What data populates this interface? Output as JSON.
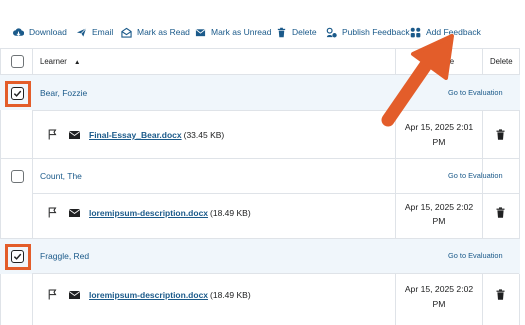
{
  "toolbar": {
    "download": "Download",
    "email": "Email",
    "mark_read": "Mark as Read",
    "mark_unread": "Mark as Unread",
    "delete": "Delete",
    "publish_feedback": "Publish Feedback",
    "add_feedback": "Add Feedback"
  },
  "table": {
    "header_learner": "Learner",
    "header_date": "ion Date",
    "header_delete": "Delete"
  },
  "rows": [
    {
      "name": "Bear, Fozzie",
      "checked": true,
      "go_eval": "Go to Evaluation",
      "file_name": "Final-Essay_Bear.docx",
      "file_size": "(33.45 KB)",
      "date_line1": "Apr 15, 2025 2:01",
      "date_line2": "PM"
    },
    {
      "name": "Count, The",
      "checked": false,
      "go_eval": "Go to Evaluation",
      "file_name": "loremipsum-description.docx",
      "file_size": "(18.49 KB)",
      "date_line1": "Apr 15, 2025 2:02",
      "date_line2": "PM"
    },
    {
      "name": "Fraggle, Red",
      "checked": true,
      "go_eval": "Go to Evaluation",
      "file_name": "loremipsum-description.docx",
      "file_size": "(18.49 KB)",
      "date_line1": "Apr 15, 2025 2:02",
      "date_line2": "PM"
    }
  ],
  "colors": {
    "link": "#1b5a8a",
    "highlight": "#e35d2a",
    "selected_row": "#f0f6fb"
  }
}
